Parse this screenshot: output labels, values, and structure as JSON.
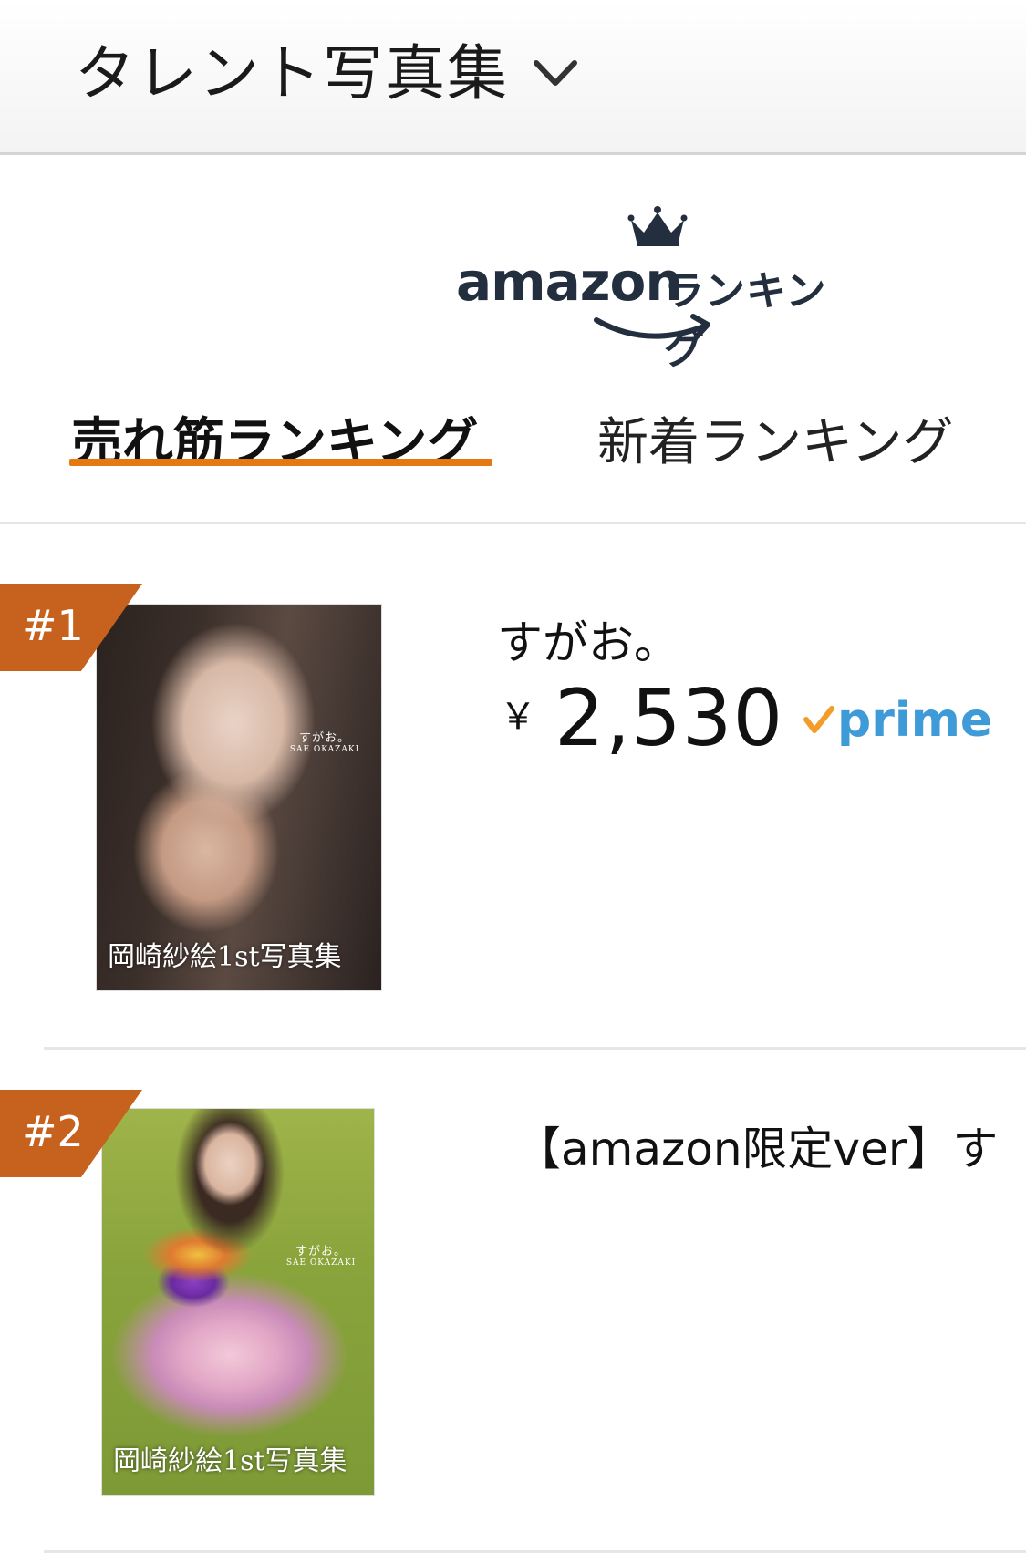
{
  "header": {
    "category_label": "タレント写真集"
  },
  "logo": {
    "brand": "amazon",
    "ranking_text": "ランキング"
  },
  "tabs": [
    {
      "label": "売れ筋ランキング",
      "active": true
    },
    {
      "label": "新着ランキング",
      "active": false
    }
  ],
  "items": [
    {
      "rank": "#1",
      "title": "すがお。",
      "currency": "￥",
      "price": "2,530",
      "prime": "prime",
      "cover_caption": "岡崎紗絵1st写真集",
      "cover_title": "すがお。",
      "cover_subtitle": "SAE OKAZAKI"
    },
    {
      "rank": "#2",
      "title": "【amazon限定ver】す",
      "cover_caption": "岡崎紗絵1st写真集",
      "cover_title": "すがお。",
      "cover_subtitle": "SAE OKAZAKI"
    }
  ],
  "colors": {
    "accent_underline": "#e47911",
    "rank_badge": "#c7611e",
    "prime_blue": "#3f9ad8",
    "prime_check": "#f39c2a",
    "logo_dark": "#232f3e"
  }
}
